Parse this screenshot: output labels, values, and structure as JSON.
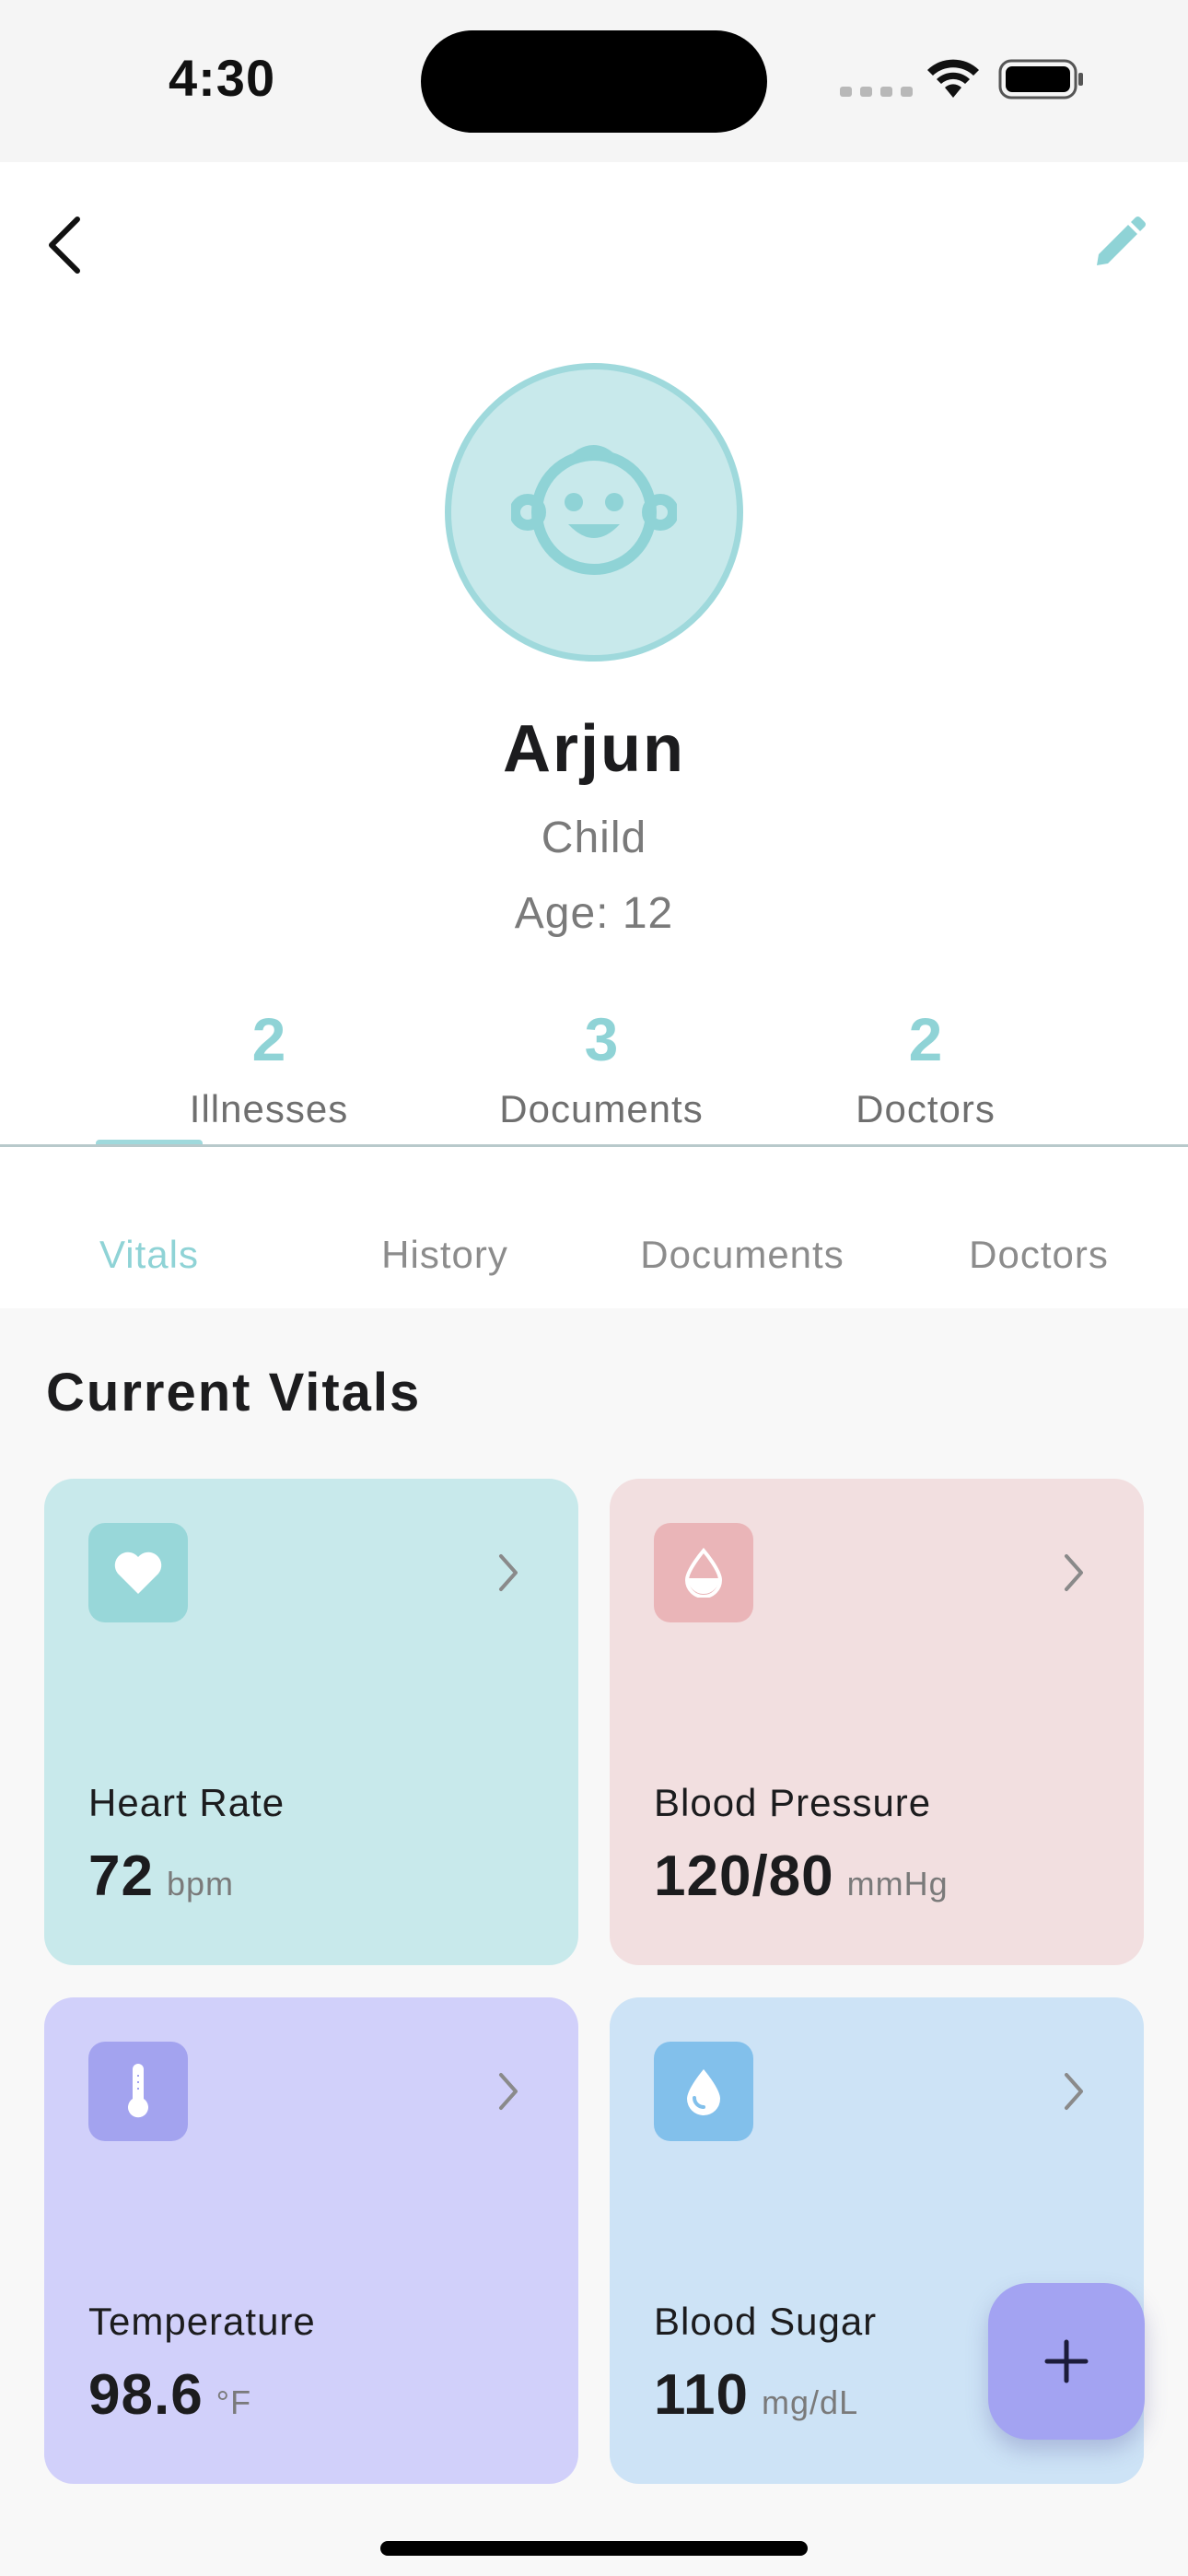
{
  "status_bar": {
    "time": "4:30"
  },
  "profile": {
    "name": "Arjun",
    "relation": "Child",
    "age": "Age: 12"
  },
  "stats": [
    {
      "value": "2",
      "label": "Illnesses"
    },
    {
      "value": "3",
      "label": "Documents"
    },
    {
      "value": "2",
      "label": "Doctors"
    }
  ],
  "tabs": [
    "Vitals",
    "History",
    "Documents",
    "Doctors"
  ],
  "active_tab": "Vitals",
  "section_title": "Current Vitals",
  "vitals": [
    {
      "label": "Heart Rate",
      "value": "72",
      "unit": "bpm",
      "icon": "heart-icon",
      "card_color": "#c8e9eb",
      "icon_color": "#98d7d9"
    },
    {
      "label": "Blood Pressure",
      "value": "120/80",
      "unit": "mmHg",
      "icon": "drop-half-icon",
      "card_color": "#f2dfe0",
      "icon_color": "#eab5b8"
    },
    {
      "label": "Temperature",
      "value": "98.6",
      "unit": "°F",
      "icon": "thermometer-icon",
      "card_color": "#d1d0fa",
      "icon_color": "#a3a3ef"
    },
    {
      "label": "Blood Sugar",
      "value": "110",
      "unit": "mg/dL",
      "icon": "drop-icon",
      "card_color": "#cde3f6",
      "icon_color": "#82c0eb"
    }
  ],
  "colors": {
    "accent": "#8fd3d6",
    "fab": "#a3a3f2"
  }
}
